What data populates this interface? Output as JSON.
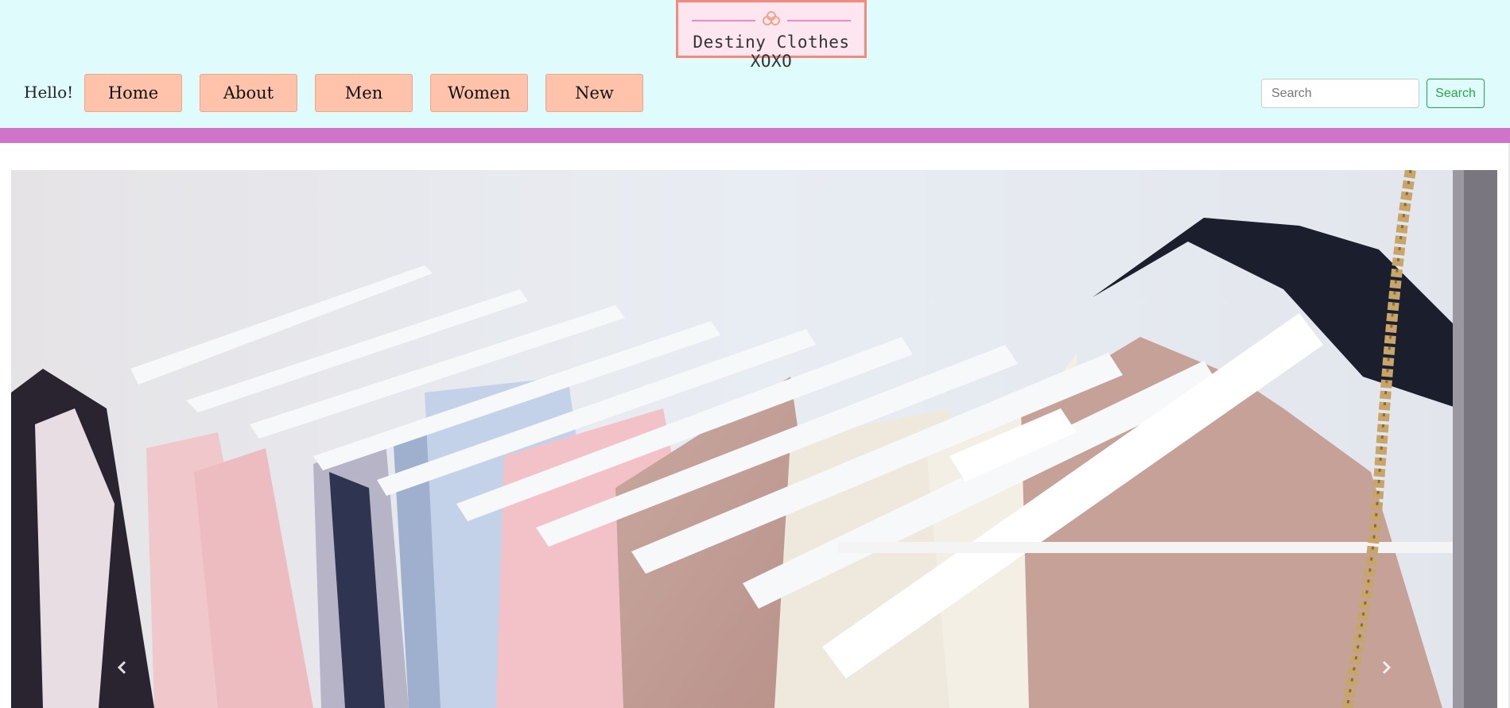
{
  "header": {
    "logo_text": "Destiny Clothes XOXO",
    "greeting": "Hello!",
    "nav": [
      {
        "label": "Home"
      },
      {
        "label": "About"
      },
      {
        "label": "Men"
      },
      {
        "label": "Women"
      },
      {
        "label": "New"
      }
    ],
    "search": {
      "placeholder": "Search",
      "button_label": "Search"
    }
  },
  "carousel": {
    "prev_icon": "chevron-left-icon",
    "next_icon": "chevron-right-icon"
  },
  "colors": {
    "header_bg": "#dffbfb",
    "nav_button_bg": "#ffc2ab",
    "accent_band": "#cf74c9",
    "logo_border": "#f48a7e",
    "search_button": "#28a745"
  }
}
